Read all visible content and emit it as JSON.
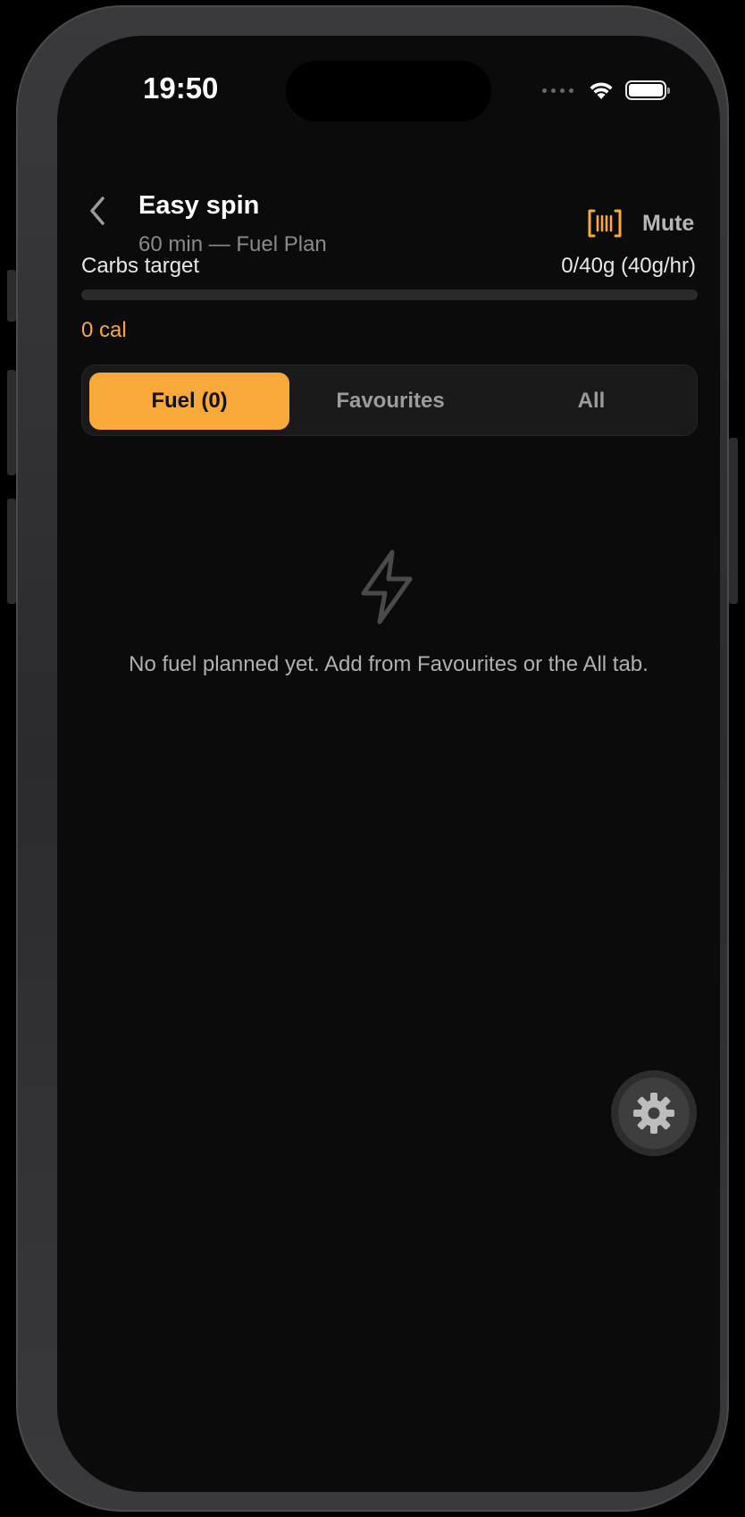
{
  "status_bar": {
    "time": "19:50",
    "wifi_icon": "wifi-icon",
    "battery_icon": "battery-icon"
  },
  "header": {
    "back_icon": "chevron-left-icon",
    "title": "Easy spin",
    "subtitle": "60 min — Fuel Plan",
    "barcode_icon": "barcode-scan-icon",
    "mute_label": "Mute"
  },
  "carbs": {
    "label": "Carbs target",
    "value": "0/40g (40g/hr)",
    "progress": 0,
    "calories": "0 cal"
  },
  "tabs": [
    {
      "label": "Fuel (0)",
      "active": true
    },
    {
      "label": "Favourites",
      "active": false
    },
    {
      "label": "All",
      "active": false
    }
  ],
  "empty_state": {
    "icon": "lightning-bolt-icon",
    "message": "No fuel planned yet. Add from Favourites or the All tab."
  },
  "fab": {
    "icon": "gear-icon"
  },
  "colors": {
    "accent": "#f9a83a",
    "background": "#0b0b0b",
    "surface": "#1a1a1a",
    "muted_text": "#8a8a8e"
  }
}
